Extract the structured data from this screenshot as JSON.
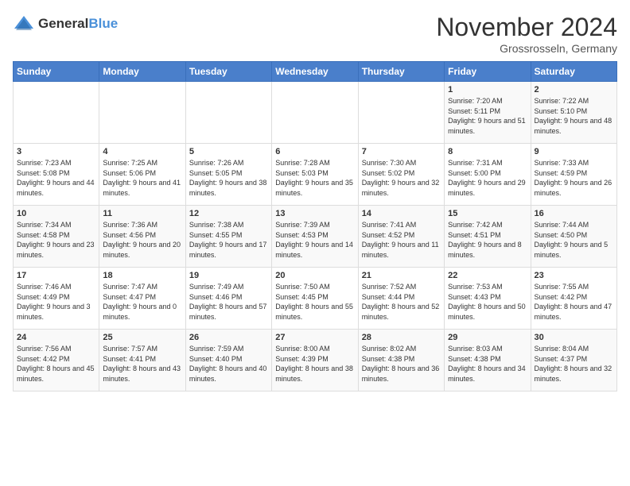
{
  "header": {
    "logo_line1": "General",
    "logo_line2": "Blue",
    "month": "November 2024",
    "location": "Grossrosseln, Germany"
  },
  "days_of_week": [
    "Sunday",
    "Monday",
    "Tuesday",
    "Wednesday",
    "Thursday",
    "Friday",
    "Saturday"
  ],
  "weeks": [
    [
      {
        "day": "",
        "info": ""
      },
      {
        "day": "",
        "info": ""
      },
      {
        "day": "",
        "info": ""
      },
      {
        "day": "",
        "info": ""
      },
      {
        "day": "",
        "info": ""
      },
      {
        "day": "1",
        "info": "Sunrise: 7:20 AM\nSunset: 5:11 PM\nDaylight: 9 hours and 51 minutes."
      },
      {
        "day": "2",
        "info": "Sunrise: 7:22 AM\nSunset: 5:10 PM\nDaylight: 9 hours and 48 minutes."
      }
    ],
    [
      {
        "day": "3",
        "info": "Sunrise: 7:23 AM\nSunset: 5:08 PM\nDaylight: 9 hours and 44 minutes."
      },
      {
        "day": "4",
        "info": "Sunrise: 7:25 AM\nSunset: 5:06 PM\nDaylight: 9 hours and 41 minutes."
      },
      {
        "day": "5",
        "info": "Sunrise: 7:26 AM\nSunset: 5:05 PM\nDaylight: 9 hours and 38 minutes."
      },
      {
        "day": "6",
        "info": "Sunrise: 7:28 AM\nSunset: 5:03 PM\nDaylight: 9 hours and 35 minutes."
      },
      {
        "day": "7",
        "info": "Sunrise: 7:30 AM\nSunset: 5:02 PM\nDaylight: 9 hours and 32 minutes."
      },
      {
        "day": "8",
        "info": "Sunrise: 7:31 AM\nSunset: 5:00 PM\nDaylight: 9 hours and 29 minutes."
      },
      {
        "day": "9",
        "info": "Sunrise: 7:33 AM\nSunset: 4:59 PM\nDaylight: 9 hours and 26 minutes."
      }
    ],
    [
      {
        "day": "10",
        "info": "Sunrise: 7:34 AM\nSunset: 4:58 PM\nDaylight: 9 hours and 23 minutes."
      },
      {
        "day": "11",
        "info": "Sunrise: 7:36 AM\nSunset: 4:56 PM\nDaylight: 9 hours and 20 minutes."
      },
      {
        "day": "12",
        "info": "Sunrise: 7:38 AM\nSunset: 4:55 PM\nDaylight: 9 hours and 17 minutes."
      },
      {
        "day": "13",
        "info": "Sunrise: 7:39 AM\nSunset: 4:53 PM\nDaylight: 9 hours and 14 minutes."
      },
      {
        "day": "14",
        "info": "Sunrise: 7:41 AM\nSunset: 4:52 PM\nDaylight: 9 hours and 11 minutes."
      },
      {
        "day": "15",
        "info": "Sunrise: 7:42 AM\nSunset: 4:51 PM\nDaylight: 9 hours and 8 minutes."
      },
      {
        "day": "16",
        "info": "Sunrise: 7:44 AM\nSunset: 4:50 PM\nDaylight: 9 hours and 5 minutes."
      }
    ],
    [
      {
        "day": "17",
        "info": "Sunrise: 7:46 AM\nSunset: 4:49 PM\nDaylight: 9 hours and 3 minutes."
      },
      {
        "day": "18",
        "info": "Sunrise: 7:47 AM\nSunset: 4:47 PM\nDaylight: 9 hours and 0 minutes."
      },
      {
        "day": "19",
        "info": "Sunrise: 7:49 AM\nSunset: 4:46 PM\nDaylight: 8 hours and 57 minutes."
      },
      {
        "day": "20",
        "info": "Sunrise: 7:50 AM\nSunset: 4:45 PM\nDaylight: 8 hours and 55 minutes."
      },
      {
        "day": "21",
        "info": "Sunrise: 7:52 AM\nSunset: 4:44 PM\nDaylight: 8 hours and 52 minutes."
      },
      {
        "day": "22",
        "info": "Sunrise: 7:53 AM\nSunset: 4:43 PM\nDaylight: 8 hours and 50 minutes."
      },
      {
        "day": "23",
        "info": "Sunrise: 7:55 AM\nSunset: 4:42 PM\nDaylight: 8 hours and 47 minutes."
      }
    ],
    [
      {
        "day": "24",
        "info": "Sunrise: 7:56 AM\nSunset: 4:42 PM\nDaylight: 8 hours and 45 minutes."
      },
      {
        "day": "25",
        "info": "Sunrise: 7:57 AM\nSunset: 4:41 PM\nDaylight: 8 hours and 43 minutes."
      },
      {
        "day": "26",
        "info": "Sunrise: 7:59 AM\nSunset: 4:40 PM\nDaylight: 8 hours and 40 minutes."
      },
      {
        "day": "27",
        "info": "Sunrise: 8:00 AM\nSunset: 4:39 PM\nDaylight: 8 hours and 38 minutes."
      },
      {
        "day": "28",
        "info": "Sunrise: 8:02 AM\nSunset: 4:38 PM\nDaylight: 8 hours and 36 minutes."
      },
      {
        "day": "29",
        "info": "Sunrise: 8:03 AM\nSunset: 4:38 PM\nDaylight: 8 hours and 34 minutes."
      },
      {
        "day": "30",
        "info": "Sunrise: 8:04 AM\nSunset: 4:37 PM\nDaylight: 8 hours and 32 minutes."
      }
    ]
  ]
}
